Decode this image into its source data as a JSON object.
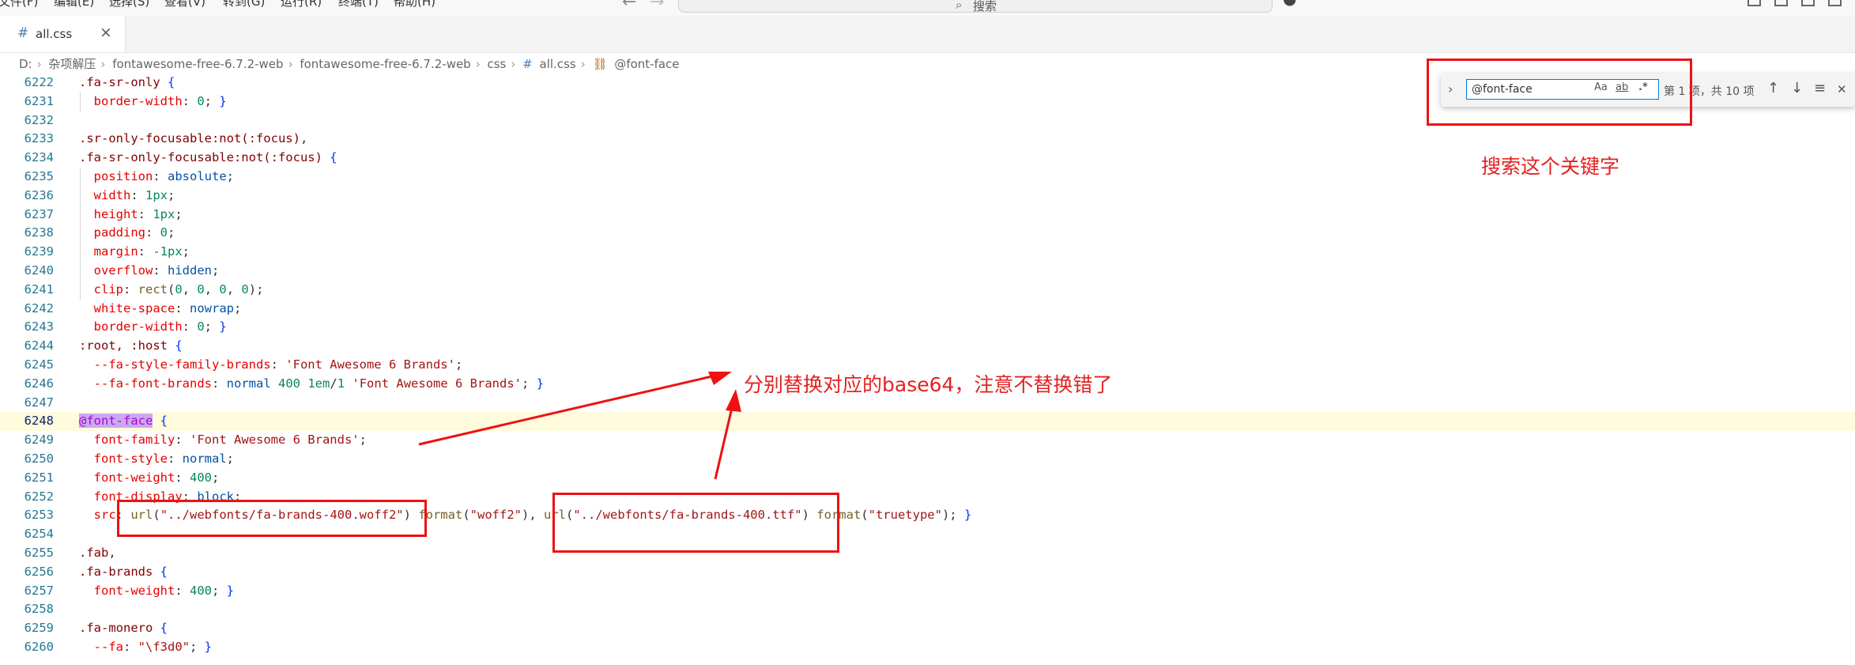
{
  "menu": {
    "items": [
      "文件(F)",
      "编辑(E)",
      "选择(S)",
      "查看(V)",
      "转到(G)",
      "运行(R)",
      "终端(T)",
      "帮助(H)"
    ],
    "search_label": "搜索"
  },
  "tab": {
    "icon": "#",
    "label": "all.css",
    "close": "×"
  },
  "breadcrumb": {
    "items": [
      "D:",
      "杂项解压",
      "fontawesome-free-6.7.2-web",
      "fontawesome-free-6.7.2-web",
      "css",
      "all.css",
      "@font-face"
    ]
  },
  "find": {
    "query": "@font-face",
    "match_case": "Aa",
    "whole_word": "ab",
    "regex": ".*",
    "count": "第 1 项，共 10 项",
    "prev": "↑",
    "next": "↓",
    "close": "✕"
  },
  "editor": {
    "line_numbers": [
      "6222",
      "6231",
      "6232",
      "6233",
      "6234",
      "6235",
      "6236",
      "6237",
      "6238",
      "6239",
      "6240",
      "6241",
      "6242",
      "6243",
      "6244",
      "6245",
      "6246",
      "6247",
      "6248",
      "6249",
      "6250",
      "6251",
      "6252",
      "6253",
      "6254",
      "6255",
      "6256",
      "6257",
      "6258",
      "6259",
      "6260"
    ],
    "current_line": "6248"
  },
  "annotations": {
    "search_hint": "搜索这个关键字",
    "replace_hint": "分别替换对应的base64，注意不替换错了"
  },
  "colors": {
    "annotation_red": "#ef1111",
    "accent": "#0078d4"
  }
}
